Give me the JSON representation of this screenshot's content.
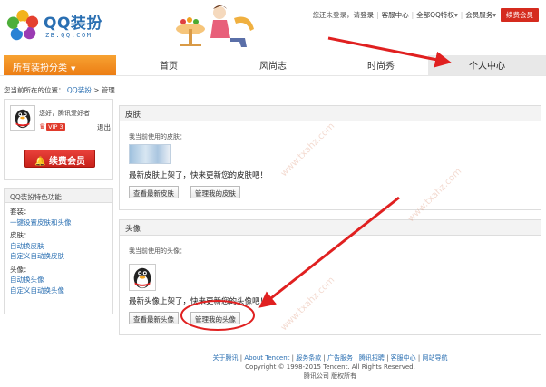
{
  "logo": {
    "title": "QQ装扮",
    "subtitle": "ZB.QQ.COM"
  },
  "topbar": {
    "login_status": "您还未登录，请",
    "login_link": "登录",
    "service": "客服中心",
    "all_vip": "全部QQ特权",
    "member_service": "会员服务",
    "renew_vip": "续费会员"
  },
  "nav": {
    "category": "所有装扮分类",
    "tabs": [
      "首页",
      "风尚志",
      "时尚秀",
      "个人中心"
    ]
  },
  "breadcrumb": {
    "prefix": "您当前所在的位置：",
    "home": "QQ装扮",
    "sep": ">",
    "current": "管理"
  },
  "user": {
    "greeting": "您好，腾讯爱好者",
    "vip_level": "VIP 3",
    "logout": "退出",
    "renew_button": "续费会员"
  },
  "features": {
    "title": "QQ装扮特色功能",
    "groups": [
      {
        "heading": "套装：",
        "links": [
          "一键设置皮肤和头像"
        ]
      },
      {
        "heading": "皮肤：",
        "links": [
          "自动换皮肤",
          "自定义自动换皮肤"
        ]
      },
      {
        "heading": "头像：",
        "links": [
          "自动换头像",
          "自定义自动换头像"
        ]
      }
    ]
  },
  "skin_panel": {
    "title": "皮肤",
    "label": "我当前使用的皮肤：",
    "message": "最新皮肤上架了，快来更新您的皮肤吧！",
    "btn_view": "查看最新皮肤",
    "btn_manage": "管理我的皮肤"
  },
  "avatar_panel": {
    "title": "头像",
    "label": "我当前使用的头像：",
    "message": "最新头像上架了，快来更新您的头像吧！",
    "btn_view": "查看最新头像",
    "btn_manage": "管理我的头像"
  },
  "footer": {
    "links": [
      "关于腾讯",
      "About Tencent",
      "服务条款",
      "广告服务",
      "腾讯招聘",
      "客服中心",
      "网站导航"
    ],
    "copyright": "Copyright © 1998-2015 Tencent. All Rights Reserved.",
    "company": "腾讯公司 版权所有"
  },
  "watermark_text": "www.txahz.com",
  "colors": {
    "brand_blue": "#2a6fb2",
    "nav_orange": "#ec7d14",
    "vip_red": "#d52b1e",
    "annotation_red": "#e02020"
  }
}
